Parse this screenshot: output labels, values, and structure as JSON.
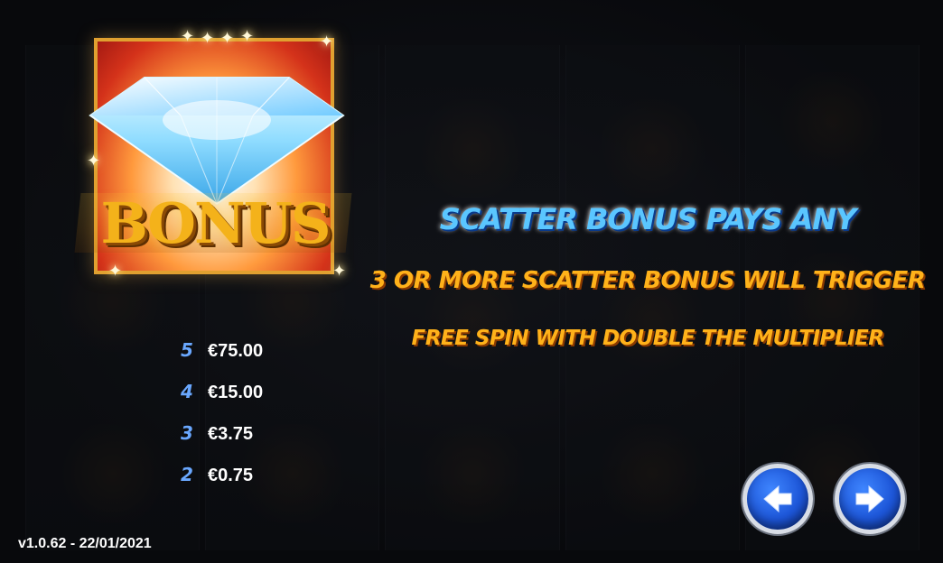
{
  "symbol": {
    "name": "BONUS",
    "icon": "diamond-bonus-icon"
  },
  "paytable": [
    {
      "count": "5",
      "value": "€75.00"
    },
    {
      "count": "4",
      "value": "€15.00"
    },
    {
      "count": "3",
      "value": "€3.75"
    },
    {
      "count": "2",
      "value": "€0.75"
    }
  ],
  "description": {
    "line1": "SCATTER BONUS PAYS ANY",
    "line2": "3 OR MORE SCATTER BONUS WILL TRIGGER",
    "line3": "FREE SPIN WITH DOUBLE THE MULTIPLIER"
  },
  "navigation": {
    "prev_icon": "arrow-left-icon",
    "next_icon": "arrow-right-icon"
  },
  "version": "v1.0.62 - 22/01/2021",
  "colors": {
    "accent_blue": "#5ac6ff",
    "accent_orange": "#ffb21a",
    "button_blue": "#1d56d8"
  }
}
